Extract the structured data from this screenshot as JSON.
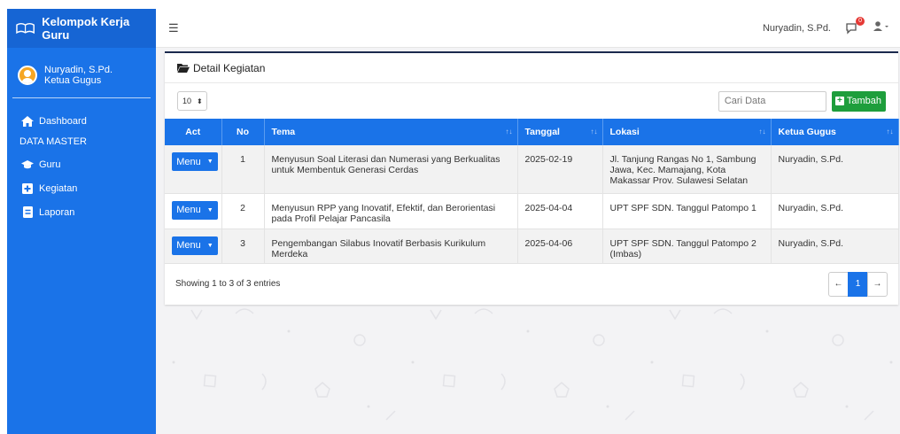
{
  "sidebar": {
    "brand": "Kelompok Kerja Guru",
    "user_name": "Nuryadin, S.Pd.",
    "user_role": "Ketua Gugus",
    "items": [
      {
        "label": "Dashboard",
        "icon": "home-icon"
      },
      {
        "label": "Guru",
        "icon": "graduation-cap-icon"
      },
      {
        "label": "Kegiatan",
        "icon": "plus-square-icon"
      },
      {
        "label": "Laporan",
        "icon": "report-icon"
      }
    ],
    "section_header": "DATA MASTER"
  },
  "topbar": {
    "user_name": "Nuryadin, S.Pd.",
    "notification_count": "0"
  },
  "card": {
    "title": "Detail Kegiatan",
    "length_value": "10",
    "search_placeholder": "Cari Data",
    "add_label": "Tambah",
    "columns": [
      "Act",
      "No",
      "Tema",
      "Tanggal",
      "Lokasi",
      "Ketua Gugus"
    ],
    "menu_label": "Menu",
    "rows": [
      {
        "no": "1",
        "tema": "Menyusun Soal Literasi dan Numerasi yang Berkualitas untuk Membentuk Generasi Cerdas",
        "tanggal": "2025-02-19",
        "lokasi": "Jl. Tanjung Rangas No 1, Sambung Jawa, Kec. Mamajang, Kota Makassar Prov. Sulawesi Selatan",
        "ketua": "Nuryadin, S.Pd."
      },
      {
        "no": "2",
        "tema": "Menyusun RPP yang Inovatif, Efektif, dan Berorientasi pada Profil Pelajar Pancasila",
        "tanggal": "2025-04-04",
        "lokasi": "UPT SPF SDN. Tanggul Patompo 1",
        "ketua": "Nuryadin, S.Pd."
      },
      {
        "no": "3",
        "tema": "Pengembangan Silabus Inovatif Berbasis Kurikulum Merdeka",
        "tanggal": "2025-04-06",
        "lokasi": "UPT SPF SDN. Tanggul Patompo 2 (Imbas)",
        "ketua": "Nuryadin, S.Pd."
      }
    ],
    "info": "Showing 1 to 3 of 3 entries",
    "pager": {
      "prev": "←",
      "current": "1",
      "next": "→"
    }
  },
  "colors": {
    "primary": "#1a73e8",
    "success": "#1e9e3c",
    "card_border": "#1b2a4e"
  }
}
